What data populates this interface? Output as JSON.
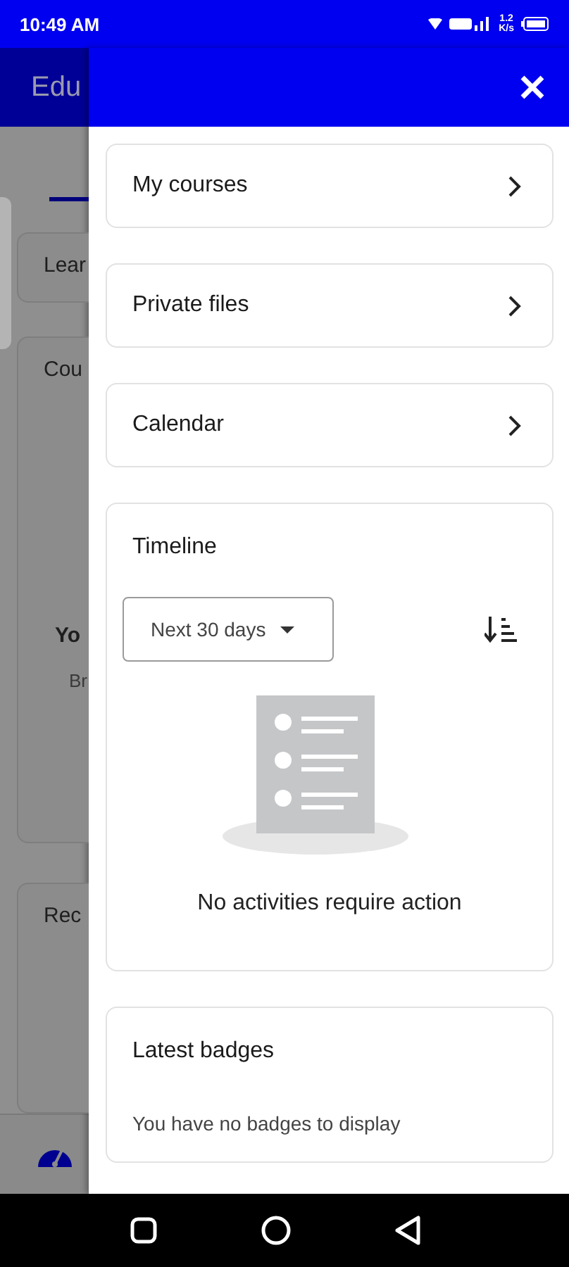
{
  "status_bar": {
    "time": "10:49 AM",
    "speed_value": "1.2",
    "speed_unit": "K/s"
  },
  "background_page": {
    "app_title": "Edu",
    "cards": [
      {
        "kind": "short",
        "title": "Lear"
      },
      {
        "kind": "course",
        "title": "Cou",
        "empty_title": "Yo",
        "empty_text": "Br"
      },
      {
        "kind": "recent",
        "title": "Rec"
      }
    ]
  },
  "drawer": {
    "links": [
      {
        "label": "My courses"
      },
      {
        "label": "Private files"
      },
      {
        "label": "Calendar"
      }
    ],
    "timeline": {
      "title": "Timeline",
      "filter": "Next 30 days",
      "empty_message": "No activities require action"
    },
    "badges": {
      "title": "Latest badges",
      "message": "You have no badges to display"
    }
  }
}
